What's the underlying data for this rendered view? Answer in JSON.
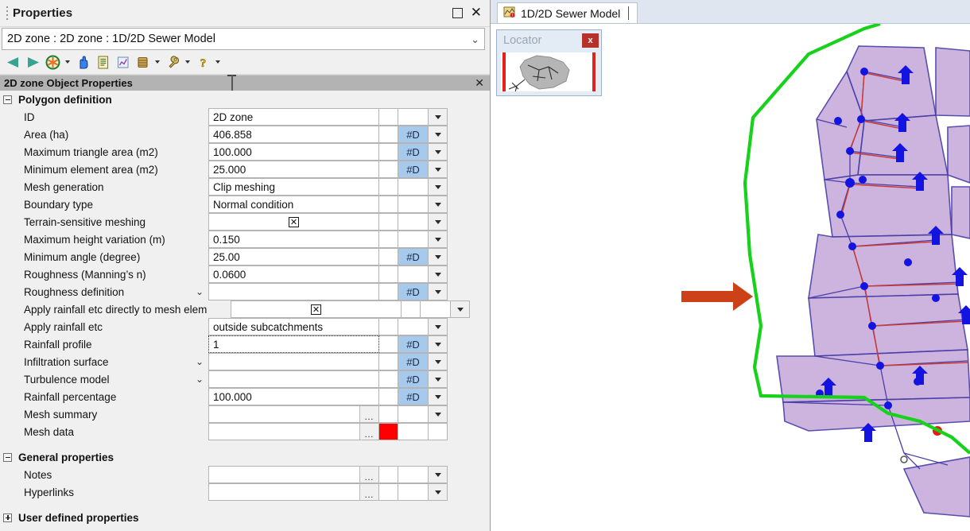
{
  "window": {
    "title": "Properties",
    "restore_icon": "restore-icon",
    "close_icon": "close-icon",
    "close_glyph": "✕"
  },
  "object_selector": {
    "value": "2D zone : 2D zone : 1D/2D Sewer Model",
    "arrow_glyph": "⌄"
  },
  "toolbar": {
    "buttons": [
      {
        "name": "back-icon",
        "glyph": "◀",
        "color": "#3aa08c",
        "has_dropdown": false
      },
      {
        "name": "forward-icon",
        "glyph": "▶",
        "color": "#3aa08c",
        "has_dropdown": false
      },
      {
        "name": "globe-refresh-icon",
        "glyph": "✹",
        "color": "#d86a16",
        "has_dropdown": true
      },
      {
        "name": "hand-pan-icon",
        "glyph": "☝",
        "color": "#2f6fd0",
        "has_dropdown": false
      },
      {
        "name": "document-properties-icon",
        "glyph": "Ὄ4",
        "color": "#c8a93a",
        "has_dropdown": false
      },
      {
        "name": "chart-graph-icon",
        "glyph": "↗",
        "color": "#5d7fb5",
        "has_dropdown": false
      },
      {
        "name": "database-icon",
        "glyph": "☰",
        "color": "#b58a3c",
        "has_dropdown": true
      },
      {
        "name": "wrench-tools-icon",
        "glyph": "ὒ7",
        "color": "#a08a38",
        "has_dropdown": true
      },
      {
        "name": "help-icon",
        "glyph": "?",
        "color": "#e0b51e",
        "has_dropdown": true
      }
    ]
  },
  "section_header": {
    "label": "2D zone Object Properties",
    "close_glyph": "✕"
  },
  "groups": [
    {
      "name": "Polygon definition",
      "expanded": true,
      "toggle": "minus",
      "rows": [
        {
          "label": "ID",
          "value": "2D zone",
          "type": "text",
          "flag": "",
          "chevron": false,
          "dots": false,
          "focus": false,
          "narrow_red": false
        },
        {
          "label": "Area (ha)",
          "value": "406.858",
          "type": "text",
          "flag": "#D",
          "chevron": false,
          "dots": false,
          "focus": false,
          "narrow_red": false
        },
        {
          "label": "Maximum triangle area (m2)",
          "value": "100.000",
          "type": "text",
          "flag": "#D",
          "chevron": false,
          "dots": false,
          "focus": false,
          "narrow_red": false
        },
        {
          "label": "Minimum element area (m2)",
          "value": "25.000",
          "type": "text",
          "flag": "#D",
          "chevron": false,
          "dots": false,
          "focus": false,
          "narrow_red": false
        },
        {
          "label": "Mesh generation",
          "value": "Clip meshing",
          "type": "text",
          "flag": "",
          "chevron": false,
          "dots": false,
          "focus": false,
          "narrow_red": false
        },
        {
          "label": "Boundary type",
          "value": "Normal condition",
          "type": "text",
          "flag": "",
          "chevron": false,
          "dots": false,
          "focus": false,
          "narrow_red": false
        },
        {
          "label": "Terrain-sensitive meshing",
          "value": "✕",
          "type": "checkbox",
          "flag": "",
          "chevron": false,
          "dots": false,
          "focus": false,
          "narrow_red": false
        },
        {
          "label": "Maximum height variation (m)",
          "value": "0.150",
          "type": "text",
          "flag": "",
          "chevron": false,
          "dots": false,
          "focus": false,
          "narrow_red": false
        },
        {
          "label": "Minimum angle (degree)",
          "value": "25.00",
          "type": "text",
          "flag": "#D",
          "chevron": false,
          "dots": false,
          "focus": false,
          "narrow_red": false
        },
        {
          "label": "Roughness (Manning’s n)",
          "value": "0.0600",
          "type": "text",
          "flag": "",
          "chevron": false,
          "dots": false,
          "focus": false,
          "narrow_red": false
        },
        {
          "label": "Roughness definition",
          "value": "",
          "type": "text",
          "flag": "#D",
          "chevron": true,
          "dots": false,
          "focus": false,
          "narrow_red": false
        },
        {
          "label": "Apply rainfall etc directly to mesh elem",
          "value": "✕",
          "type": "checkbox",
          "flag": "",
          "chevron": false,
          "dots": false,
          "focus": false,
          "narrow_red": false,
          "wide": true
        },
        {
          "label": "Apply rainfall etc",
          "value": "outside subcatchments",
          "type": "text",
          "flag": "",
          "chevron": false,
          "dots": false,
          "focus": false,
          "narrow_red": false
        },
        {
          "label": "Rainfall profile",
          "value": "1",
          "type": "text",
          "flag": "#D",
          "chevron": false,
          "dots": false,
          "focus": true,
          "narrow_red": false
        },
        {
          "label": "Infiltration surface",
          "value": "",
          "type": "text",
          "flag": "#D",
          "chevron": true,
          "dots": false,
          "focus": false,
          "narrow_red": false
        },
        {
          "label": "Turbulence model",
          "value": "",
          "type": "text",
          "flag": "#D",
          "chevron": true,
          "dots": false,
          "focus": false,
          "narrow_red": false
        },
        {
          "label": "Rainfall percentage",
          "value": "100.000",
          "type": "text",
          "flag": "#D",
          "chevron": false,
          "dots": false,
          "focus": false,
          "narrow_red": false
        },
        {
          "label": "Mesh summary",
          "value": "",
          "type": "text",
          "flag": "",
          "chevron": false,
          "dots": true,
          "focus": false,
          "narrow_red": false
        },
        {
          "label": "Mesh data",
          "value": "",
          "type": "text",
          "flag": "",
          "chevron": false,
          "dots": true,
          "focus": false,
          "narrow_red": true,
          "no_drop": true
        }
      ]
    },
    {
      "name": "General properties",
      "expanded": true,
      "toggle": "minus",
      "rows": [
        {
          "label": "Notes",
          "value": "",
          "type": "text",
          "flag": "",
          "chevron": false,
          "dots": true,
          "focus": false,
          "narrow_red": false
        },
        {
          "label": "Hyperlinks",
          "value": "",
          "type": "text",
          "flag": "",
          "chevron": false,
          "dots": true,
          "focus": false,
          "narrow_red": false
        }
      ]
    },
    {
      "name": "User defined properties",
      "expanded": false,
      "toggle": "plus",
      "rows": []
    }
  ],
  "map": {
    "tab_label": "1D/2D Sewer Model",
    "tab_icon": "map-document-icon",
    "locator": {
      "title": "Locator",
      "close_label": "x",
      "bar_color": "#e8201a"
    },
    "colors": {
      "boundary": "#16d21b",
      "polygon_fill": "#c9aedd",
      "polygon_stroke": "#4a3fa8",
      "node": "#1414e0",
      "link": "#d03030",
      "annotation_arrow": "#cc4118"
    },
    "annotation_arrow": "pointer-arrow-icon"
  },
  "flag_badge_color": "#a6c9ec"
}
